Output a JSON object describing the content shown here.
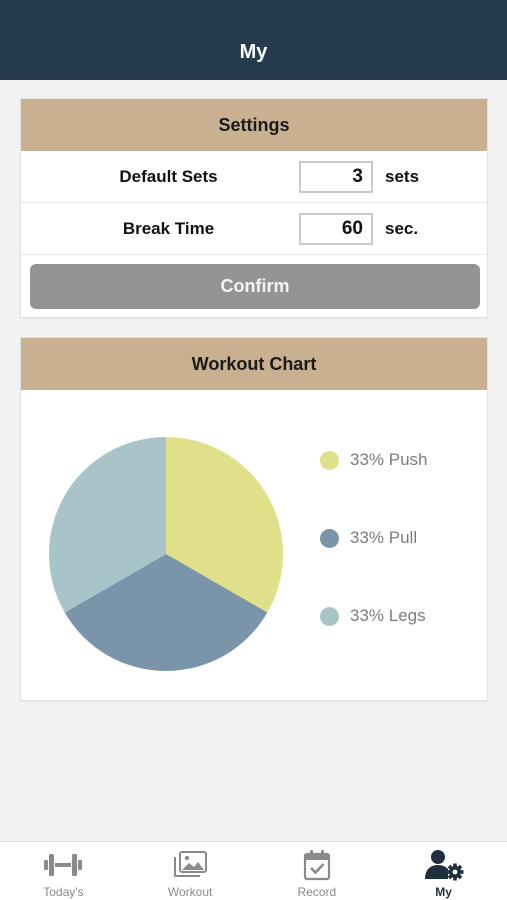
{
  "header": {
    "title": "My"
  },
  "settings": {
    "title": "Settings",
    "rows": [
      {
        "label": "Default Sets",
        "value": "3",
        "unit": "sets"
      },
      {
        "label": "Break Time",
        "value": "60",
        "unit": "sec."
      }
    ],
    "confirm_label": "Confirm"
  },
  "chart": {
    "title": "Workout Chart",
    "legend": [
      {
        "label": "33% Push",
        "color": "#e0df8a"
      },
      {
        "label": "33% Pull",
        "color": "#7a94a9"
      },
      {
        "label": "33% Legs",
        "color": "#a8c4c8"
      }
    ]
  },
  "chart_data": {
    "type": "pie",
    "categories": [
      "Push",
      "Pull",
      "Legs"
    ],
    "values": [
      33,
      33,
      33
    ],
    "colors": [
      "#e0df8a",
      "#7a94a9",
      "#a8c4c8"
    ],
    "title": "Workout Chart",
    "legend_position": "right"
  },
  "tabbar": {
    "items": [
      {
        "label": "Today's",
        "icon": "dumbbell-icon"
      },
      {
        "label": "Workout",
        "icon": "photo-gallery-icon"
      },
      {
        "label": "Record",
        "icon": "calendar-check-icon"
      },
      {
        "label": "My",
        "icon": "user-settings-icon"
      }
    ],
    "active_index": 3
  }
}
